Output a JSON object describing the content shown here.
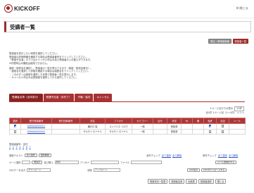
{
  "header": {
    "logo_text": "KICKOFF",
    "close_label": "閉じる",
    "close_icon": "close-circle-icon"
  },
  "page": {
    "title": "受講者一覧"
  },
  "top_buttons": [
    {
      "label": "受注・研修者情報"
    },
    {
      "label": "受講者一覧"
    }
  ],
  "info_lines": [
    "受講者を表示したい研修を選択してください。",
    "受講者の詳細情報を確認する場合は受講者番号をクリックしてください。",
    "「受講予定者」タブではキャンセル申込み及び受講者の入れ替えができます。",
    "※代理申込み機能は使用できません。",
    "",
    "講座・研修会を選択し、受講者の一覧を表示させます（講座・研修会単位）。",
    "・講座名を選択して詳細を確認する場合は講座名をクリックしてください。",
    "・このボタンは講座を選択した状態で受講者一覧を表示します。",
    "・キャンセル申込みは受講者を選択してから操作してください。"
  ],
  "tabs": [
    {
      "label": "受講者名簿（全体表示）",
      "active": true
    },
    {
      "label": "受講予定者（未完了）",
      "active": false
    },
    {
      "label": "不備／保存",
      "active": false
    },
    {
      "label": "キャンセル",
      "active": false
    }
  ],
  "pager": {
    "per_page_label": "1ページ当たりの表示",
    "per_page_value": "20件",
    "summary": "全2件 1ページ目（1〜2件）",
    "nav": "< 1 >"
  },
  "table": {
    "columns": [
      "選択",
      "受付受講番号",
      "受付団体番号",
      "氏名",
      "フリガナ",
      "カテゴリー",
      "区分",
      "状況",
      "FA",
      "備",
      "免許",
      "合否",
      "メール"
    ],
    "rows": [
      {
        "col1": "KURANA000001",
        "col2": "",
        "col3": "瀬戸口 瑞",
        "col4": "スンバリエ ジロウ",
        "col5": "一般",
        "col6": "",
        "col7": "受講済",
        "col8": "",
        "col9": "",
        "col10": "",
        "col11": "",
        "col12": "",
        "checked": true
      },
      {
        "col1": "KURANA000002",
        "col2": "",
        "col3": "サカモト ロイヤル",
        "col4": "サカモト ロイヤル",
        "col5": "一般",
        "col6": "",
        "col7": "受講済",
        "col8": "",
        "col9": "",
        "col10": "",
        "col11": "",
        "col12": "",
        "checked": false
      }
    ]
  },
  "pagination": {
    "label": "受講者番号：全件",
    "pages_line_1": "〜1件 〜2件 〜3件 〜4件 〜5件 〜6件 〜7件",
    "pages": [
      "1",
      "2",
      "3",
      "4",
      "5",
      "6",
      "7"
    ]
  },
  "controls": {
    "search_label": "講座テキスト",
    "search_button": "全て選択",
    "select_button": "選択解除",
    "right_check_label": "全件チェック",
    "right_check_a": "全て選択",
    "right_check_b": "全て解除",
    "right_check_label_2": "条件チェック",
    "page_label": "ページ選択",
    "page_button": "再表示",
    "sort_label": "並び替え",
    "sort_select": "昇順",
    "furigana_label": "フリガナ",
    "furigana_select": "",
    "file_label": "ファイル",
    "file_select": "",
    "mail_button": "メール送信をする",
    "csv_label": "CSVデータ出力",
    "csv_select": "ダウンロード",
    "status_label": "状態",
    "upload_select": "アップロード",
    "csv_button": "CSV出力",
    "output_button": "CSVダウンロードする"
  },
  "bottom_buttons": [
    {
      "label": "受講状況一覧表"
    },
    {
      "label": "受講者名簿"
    },
    {
      "label": "出席表"
    },
    {
      "label": "受講者選択"
    },
    {
      "label": "閉じる"
    }
  ],
  "colors": {
    "accent": "#a63232",
    "link": "#2a56c6",
    "check_on": "#2f6fd6"
  }
}
